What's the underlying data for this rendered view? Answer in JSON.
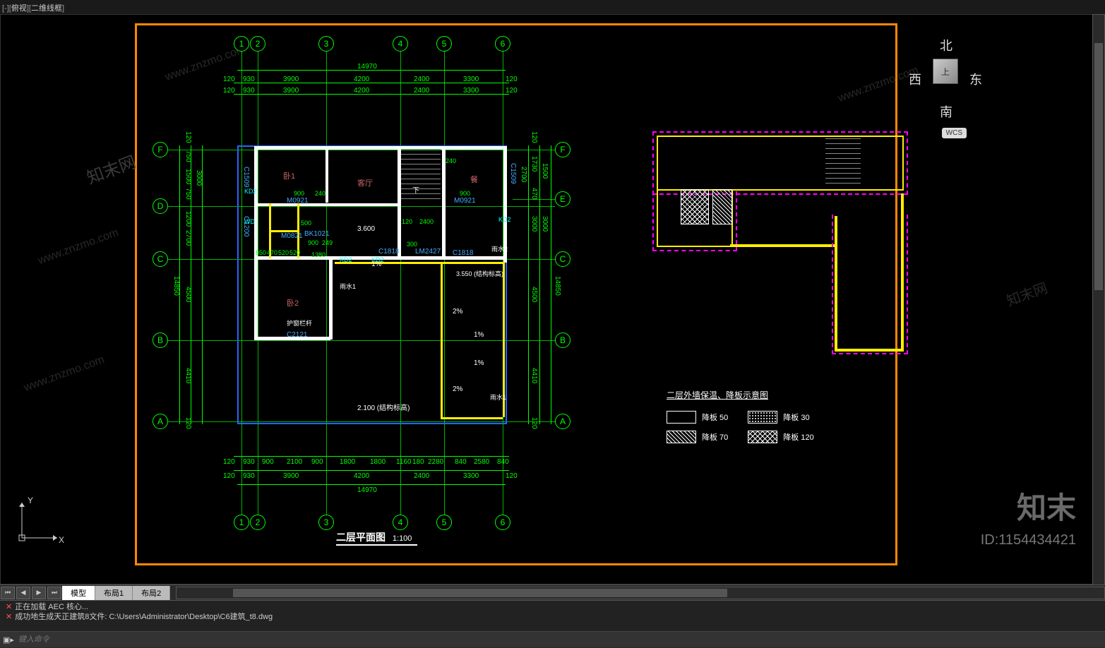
{
  "viewport_label": {
    "prefix": "[-][",
    "mode": "俯视",
    "sep": "][",
    "style": "二维线框",
    "suffix": "]"
  },
  "viewcube": {
    "north": "北",
    "south": "南",
    "east": "东",
    "west": "西",
    "top": "上",
    "wcs": "WCS"
  },
  "grid_cols": [
    "1",
    "2",
    "3",
    "4",
    "5",
    "6"
  ],
  "grid_rows_left": [
    "F",
    "D",
    "C",
    "B",
    "A"
  ],
  "grid_rows_right": [
    "F",
    "E",
    "C",
    "B",
    "A"
  ],
  "dims_top": {
    "total": "14970",
    "seg": [
      "120",
      "930",
      "3900",
      "4200",
      "2400",
      "3300",
      "120"
    ],
    "seg2": [
      "120",
      "930",
      "3900",
      "4200",
      "2400",
      "3300",
      "120"
    ]
  },
  "dims_bottom": {
    "total": "14970",
    "seg": [
      "120",
      "930",
      "900",
      "2100",
      "900",
      "1800",
      "1800",
      "1160",
      "180",
      "2280",
      "840",
      "2580",
      "840",
      "120"
    ],
    "seg2": [
      "120",
      "930",
      "3900",
      "4200",
      "2400",
      "3300",
      "120"
    ]
  },
  "dims_left": {
    "total": "14850",
    "top_group": [
      "120",
      "750",
      "1500",
      "750",
      "1200",
      "2700",
      "120"
    ],
    "bot_group": [
      "4500",
      "4410",
      "120",
      "120"
    ],
    "tot2": "3000"
  },
  "dims_right": {
    "total": "14850",
    "group": [
      "120",
      "1730",
      "470",
      "3000",
      "4500",
      "4410",
      "120",
      "120"
    ],
    "sub": [
      "1500",
      "2700",
      "3000"
    ]
  },
  "rooms": {
    "bedroom1": "卧1",
    "bedroom2": "卧2",
    "living": "客厅",
    "dining": "餐",
    "stair_down": "下",
    "elev": "3.600",
    "elev2": "2.100 (结构标高)",
    "elev3": "3.550 (结构标高)",
    "slope1": "1%",
    "slope2": "2%",
    "rail": "护窗栏杆",
    "drain1": "雨水1",
    "drain2": "雨水2",
    "drain3": "雨水1"
  },
  "tags": {
    "c1509": "C1509",
    "m0921": "M0921",
    "c1818": "C1818",
    "lm2427": "LM2427",
    "c2121": "C2121",
    "m0821": "M0821",
    "c1200": "C1200",
    "bk1021": "BK1021",
    "kd2": "KD2",
    "wd": "WD"
  },
  "small_dims": [
    "900",
    "240",
    "900",
    "300",
    "120",
    "2400",
    "1380",
    "850",
    "470",
    "520",
    "520",
    "900",
    "500",
    "249"
  ],
  "titles": {
    "plan": "二层平面图",
    "plan_scale": "1:100",
    "schematic": "二层外墙保温、降板示意图"
  },
  "legend": {
    "b50": "降板 50",
    "b30": "降板 30",
    "b70": "降板 70",
    "b120": "降板 120"
  },
  "ucs": {
    "x": "X",
    "y": "Y"
  },
  "tabs": {
    "model": "模型",
    "layout1": "布局1",
    "layout2": "布局2"
  },
  "cmd": {
    "line1": "正在加载 AEC 核心...",
    "line2": "成功地生成天正建筑8文件: C:\\Users\\Administrator\\Desktop\\C6建筑_t8.dwg",
    "prompt": "",
    "placeholder": "键入命令"
  },
  "watermarks": [
    "www.znzmo.com",
    "www.znzmo.com",
    "www.znzmo.com",
    "www.znzmo.com",
    "知末网",
    "知末网"
  ],
  "brand": "知末",
  "image_id": "ID:1154434421"
}
